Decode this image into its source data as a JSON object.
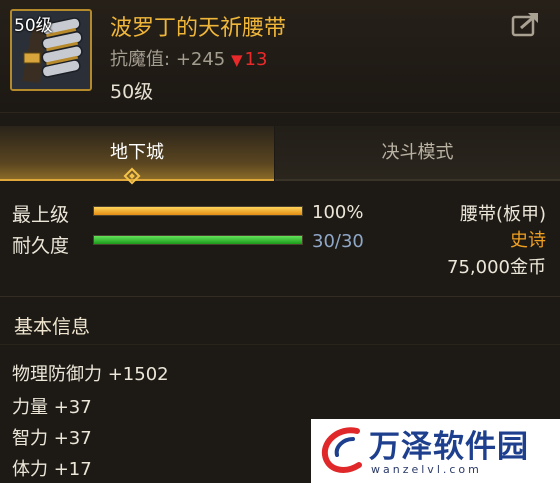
{
  "item": {
    "level_badge": "50级",
    "name": "波罗丁的天祈腰带",
    "resist_label": "抗魔值:",
    "resist_value": "+245",
    "resist_delta_icon": "down-triangle",
    "resist_delta": "13",
    "required_level": "50级"
  },
  "tabs": [
    {
      "label": "地下城",
      "active": true
    },
    {
      "label": "决斗模式",
      "active": false
    }
  ],
  "stats_bars": [
    {
      "label": "最上级",
      "percent": 100,
      "value_text": "100%",
      "color": "#f0a020",
      "value_color": "#ece6d8"
    },
    {
      "label": "耐久度",
      "percent": 100,
      "value_text": "30/30",
      "color": "#2ab52a",
      "value_color": "#8fa7c7"
    }
  ],
  "right_info": {
    "type": "腰带(板甲)",
    "rarity": "史诗",
    "rarity_color": "#f0a020",
    "price": "75,000金币"
  },
  "basic_info": {
    "title": "基本信息",
    "lines": [
      "物理防御力 +1502",
      "力量 +37",
      "智力 +37",
      "体力 +17"
    ]
  },
  "watermark": {
    "title": "万泽软件园",
    "url": "wanzelvl.com",
    "brand_color": "#1d3f8e",
    "accent_color": "#e0282a"
  }
}
